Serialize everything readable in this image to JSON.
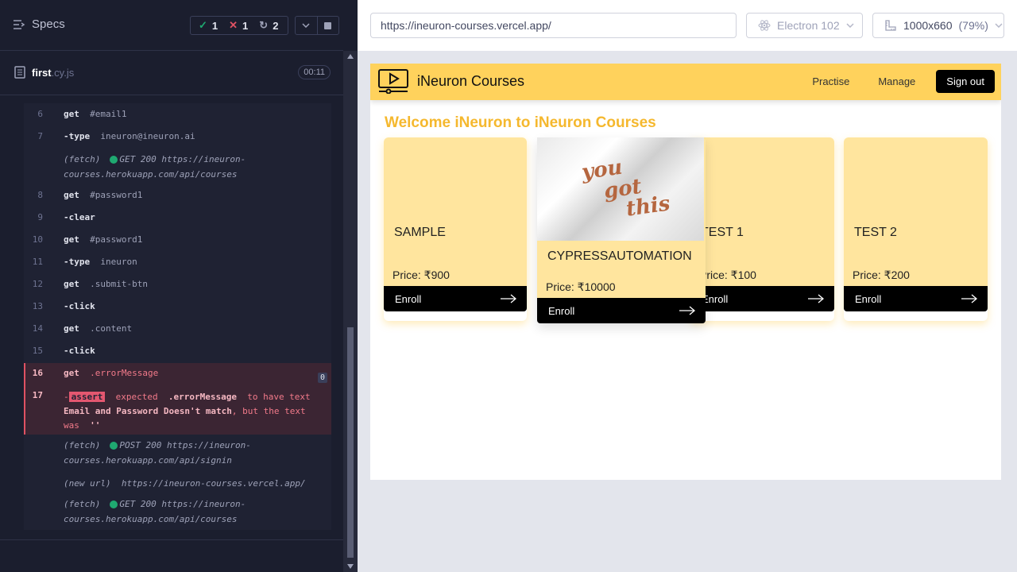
{
  "runner": {
    "specs_label": "Specs",
    "stats": {
      "passed": "1",
      "failed": "1",
      "pending": "2"
    },
    "spec_file": {
      "name": "first",
      "ext": ".cy.js",
      "duration": "00:11"
    },
    "log": [
      {
        "num": "6",
        "cmd": "get",
        "arg": "#email1"
      },
      {
        "num": "7",
        "cmd": "-type",
        "arg": "ineuron@ineuron.ai"
      },
      {
        "fetch": "(fetch)",
        "line1": "GET 200 https://ineuron-",
        "line2": "courses.herokuapp.com/api/courses"
      },
      {
        "num": "8",
        "cmd": "get",
        "arg": "#password1"
      },
      {
        "num": "9",
        "cmd": "-clear",
        "arg": ""
      },
      {
        "num": "10",
        "cmd": "get",
        "arg": "#password1"
      },
      {
        "num": "11",
        "cmd": "-type",
        "arg": "ineuron"
      },
      {
        "num": "12",
        "cmd": "get",
        "arg": ".submit-btn"
      },
      {
        "num": "13",
        "cmd": "-click",
        "arg": ""
      },
      {
        "num": "14",
        "cmd": "get",
        "arg": ".content"
      },
      {
        "num": "15",
        "cmd": "-click",
        "arg": ""
      }
    ],
    "error": {
      "num16": "16",
      "cmd16": "get",
      "arg16": ".errorMessage",
      "badge": "0",
      "num17": "17",
      "dash": "-",
      "assert": "assert",
      "expected": "expected",
      "selector": ".errorMessage",
      "to_have": "to have text",
      "text": "Email and Password Doesn't match",
      "but": ", but the text",
      "was": "was",
      "empty": "''"
    },
    "after": [
      {
        "label": "(fetch)",
        "line1": "POST 200 https://ineuron-",
        "line2": "courses.herokuapp.com/api/signin"
      },
      {
        "label": "(new url)",
        "line1": "https://ineuron-courses.vercel.app/"
      },
      {
        "label": "(fetch)",
        "line1": "GET 200 https://ineuron-",
        "line2": "courses.herokuapp.com/api/courses"
      }
    ]
  },
  "browser": {
    "url": "https://ineuron-courses.vercel.app/",
    "name": "Electron 102",
    "viewport": "1000x660",
    "zoom": "(79%)"
  },
  "app": {
    "brand": "iNeuron Courses",
    "nav": [
      "Practise",
      "Manage"
    ],
    "signout": "Sign out",
    "welcome": "Welcome iNeuron to iNeuron Courses",
    "cards": [
      {
        "title": "SAMPLE",
        "price": "Price: ₹900",
        "enroll": "Enroll"
      },
      {
        "title": "CYPRESSAUTOMATION",
        "price": "Price: ₹10000",
        "enroll": "Enroll",
        "image_words": [
          "you",
          "got",
          "this"
        ]
      },
      {
        "title": "TEST 1",
        "price": "Price: ₹100",
        "enroll": "Enroll"
      },
      {
        "title": "TEST 2",
        "price": "Price: ₹200",
        "enroll": "Enroll"
      }
    ]
  },
  "colors": {
    "accent": "#ffd25c",
    "card_bg": "#ffe59e",
    "pass": "#1fa971",
    "fail": "#e05263"
  },
  "icons": [
    "specs-list-icon",
    "check-icon",
    "x-icon",
    "pending-icon",
    "chevron-down-icon",
    "stop-icon",
    "file-icon",
    "electron-icon",
    "ruler-icon",
    "video-play-icon",
    "arrow-right-icon"
  ]
}
